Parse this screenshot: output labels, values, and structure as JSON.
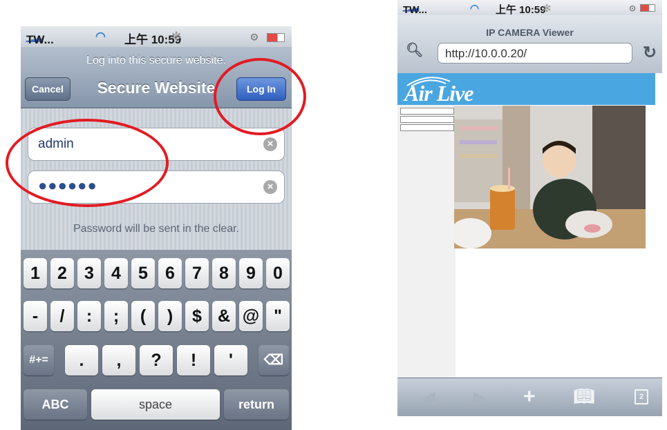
{
  "left_phone": {
    "status": {
      "carrier": "TW...",
      "time": "上午 10:59"
    },
    "navbar": {
      "prompt": "Log into this secure website.",
      "title": "Secure Website",
      "cancel_label": "Cancel",
      "login_label": "Log In"
    },
    "form": {
      "username_value": "admin",
      "password_value": "●●●●●●",
      "notice": "Password will be sent in the clear."
    },
    "keyboard": {
      "row1": [
        "1",
        "2",
        "3",
        "4",
        "5",
        "6",
        "7",
        "8",
        "9",
        "0"
      ],
      "row2": [
        "-",
        "/",
        ":",
        ";",
        "(",
        ")",
        "$",
        "&",
        "@",
        "\""
      ],
      "row3_left": "#+=",
      "row3": [
        ".",
        ",",
        "?",
        "!",
        "'"
      ],
      "backspace_icon": "backspace-icon",
      "abc_label": "ABC",
      "space_label": "space",
      "return_label": "return"
    },
    "annotation_color": "#e21b22"
  },
  "right_phone": {
    "status": {
      "carrier": "TW...",
      "time": "上午 10:59"
    },
    "page_title": "IP CAMERA Viewer",
    "url": "http://10.0.0.20/",
    "brand": "Air Live",
    "banner_color": "#4aa6e0",
    "tabs_count": "2",
    "toolbar_icons": [
      "back-icon",
      "forward-icon",
      "add-icon",
      "bookmarks-icon",
      "pages-icon"
    ]
  }
}
